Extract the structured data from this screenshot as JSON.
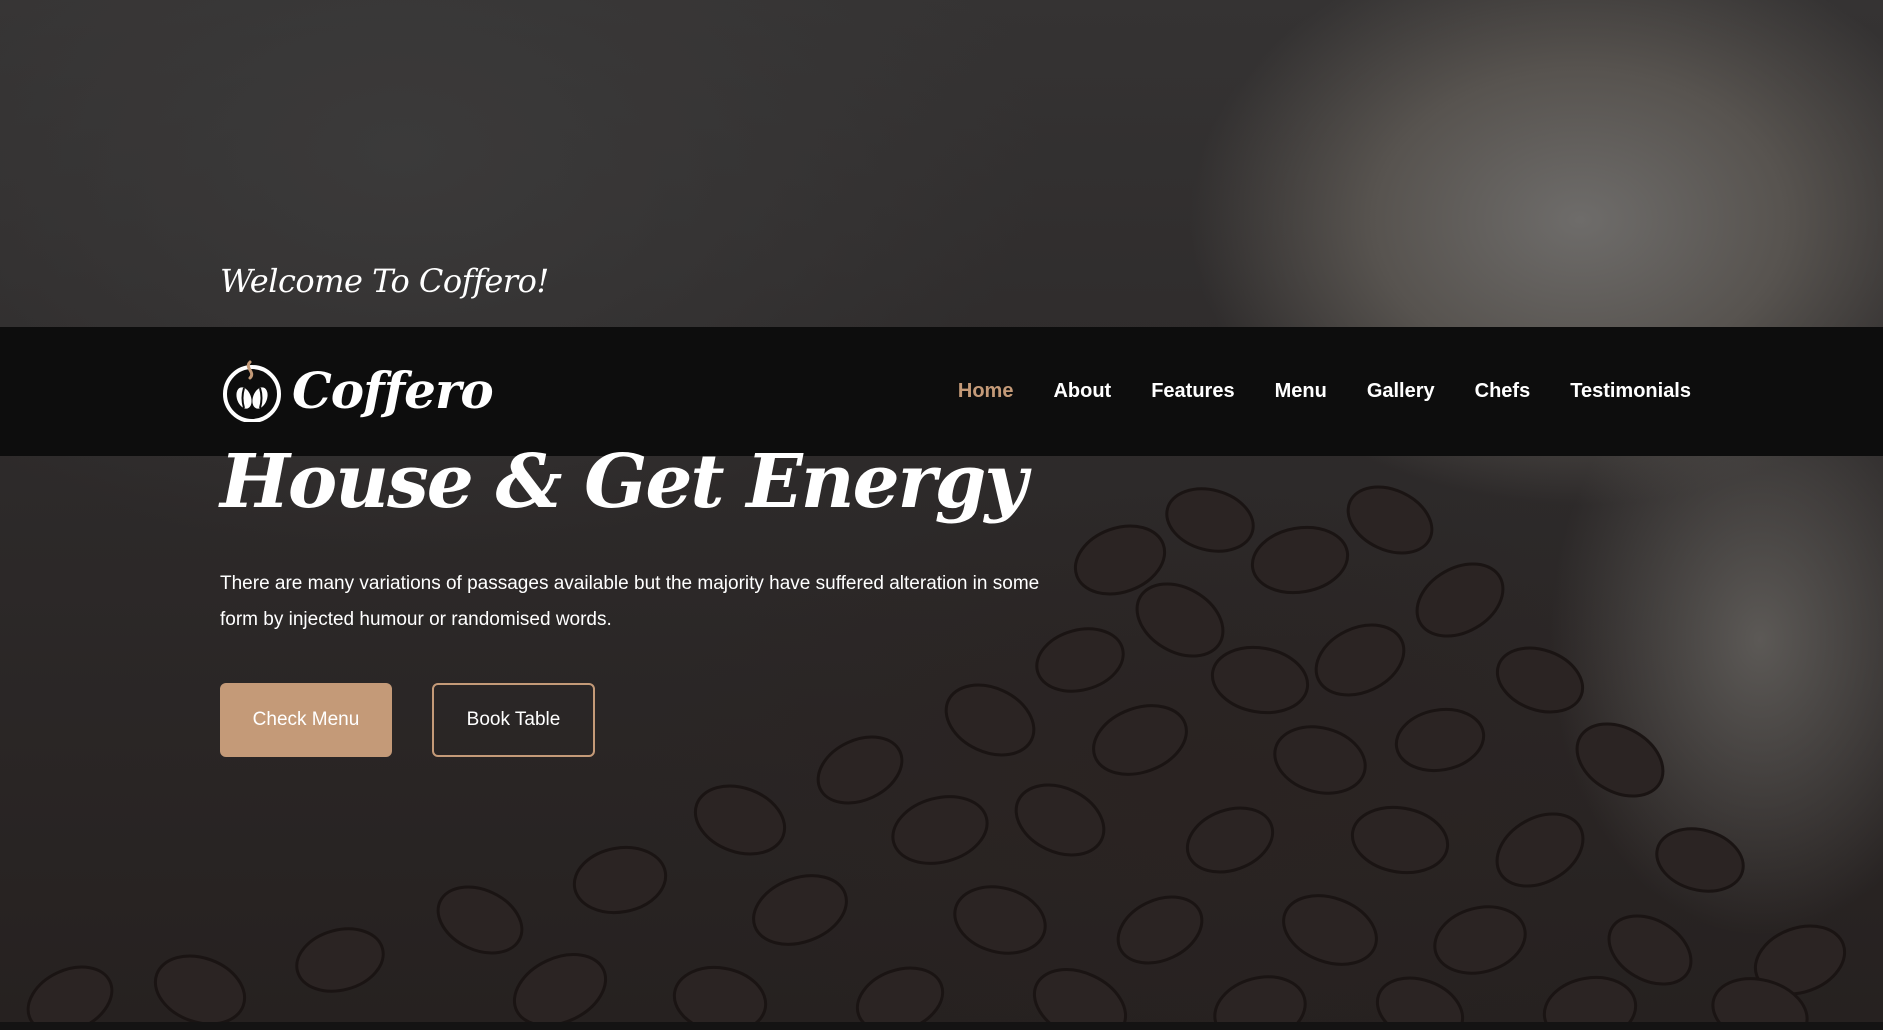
{
  "hero": {
    "welcome": "Welcome To Coffero!",
    "headline": "House & Get Energy",
    "description": "There are many variations of passages available but the majority have suffered alteration in some form by injected humour or randomised words.",
    "primary_button": "Check Menu",
    "secondary_button": "Book Table"
  },
  "brand": {
    "name": "Coffero",
    "logo_icon": "coffee-bean-cup-icon"
  },
  "nav": {
    "items": [
      {
        "label": "Home",
        "active": true
      },
      {
        "label": "About",
        "active": false
      },
      {
        "label": "Features",
        "active": false
      },
      {
        "label": "Menu",
        "active": false
      },
      {
        "label": "Gallery",
        "active": false
      },
      {
        "label": "Chefs",
        "active": false
      },
      {
        "label": "Testimonials",
        "active": false
      }
    ]
  },
  "colors": {
    "accent": "#c49a78",
    "navbar_bg": "#0d0d0d",
    "text": "#ffffff"
  }
}
